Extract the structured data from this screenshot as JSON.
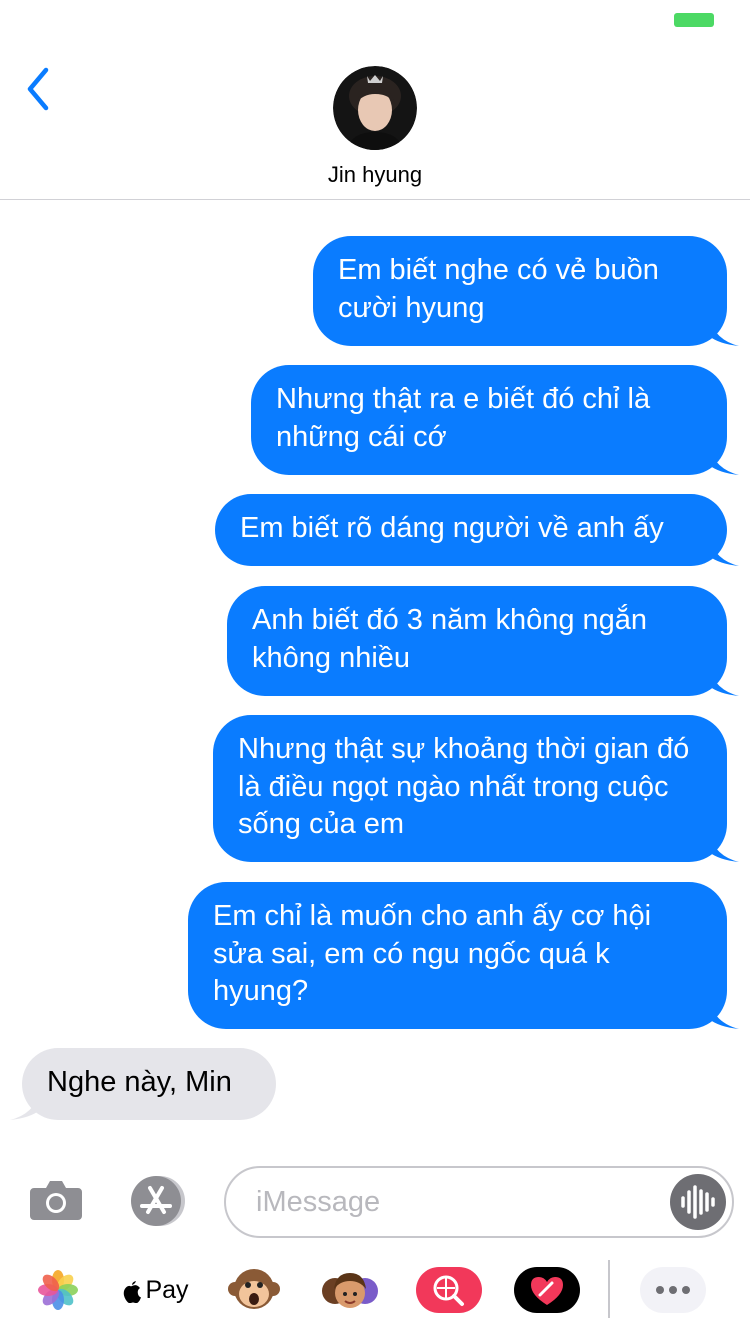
{
  "contact": {
    "name": "Jin hyung"
  },
  "messages": [
    {
      "side": "out",
      "text": "Em biết nghe có vẻ buồn cười hyung"
    },
    {
      "side": "out",
      "text": "Nhưng thật ra e biết đó chỉ là những cái cớ"
    },
    {
      "side": "out",
      "text": "Em biết rõ dáng người về anh ấy"
    },
    {
      "side": "out",
      "text": "Anh biết đó 3 năm không ngắn không nhiều"
    },
    {
      "side": "out",
      "text": "Nhưng thật sự khoảng thời gian đó là điều ngọt ngào nhất trong cuộc sống của em"
    },
    {
      "side": "out",
      "text": "Em chỉ là muốn cho anh ấy cơ hội sửa sai, em có ngu ngốc quá k hyung?"
    },
    {
      "side": "in",
      "text": "Nghe này, Min"
    }
  ],
  "composer": {
    "placeholder": "iMessage"
  },
  "apps": {
    "apple_pay": "Pay"
  },
  "colors": {
    "outgoing": "#0a7cff",
    "incoming": "#e5e5ea",
    "accent": "#0a7cff",
    "battery": "#4cd964"
  },
  "icons": [
    "back-chevron-icon",
    "camera-icon",
    "app-store-icon",
    "audio-waveform-icon",
    "photos-icon",
    "apple-logo-icon",
    "monkey-animoji-icon",
    "memoji-icon",
    "web-search-icon",
    "digital-touch-heart-icon",
    "more-icon"
  ]
}
